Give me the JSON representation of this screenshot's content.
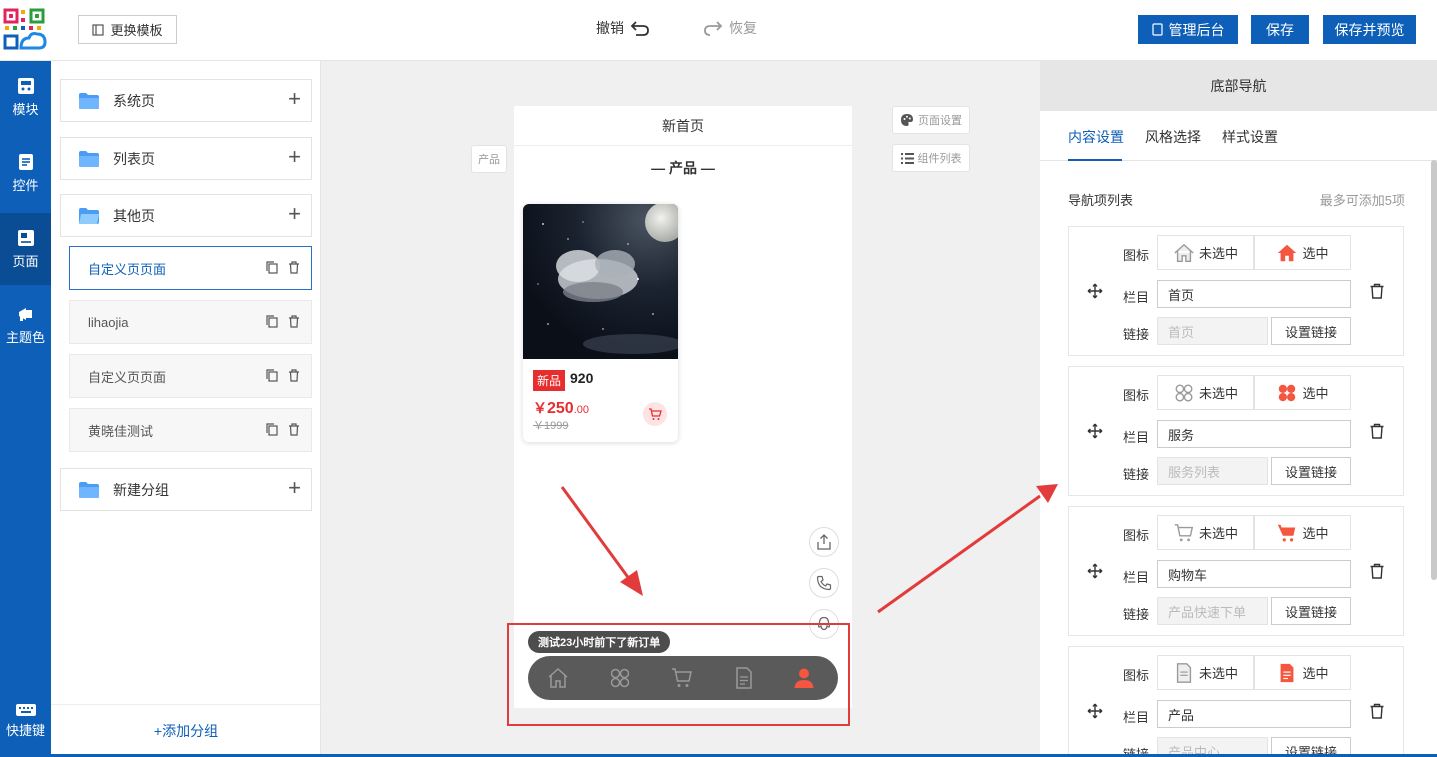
{
  "header": {
    "template_btn": "更换模板",
    "undo": "撤销",
    "redo": "恢复",
    "admin_btn": "管理后台",
    "save_btn": "保存",
    "save_preview_btn": "保存并预览"
  },
  "sidebar": {
    "items": [
      {
        "label": "模块",
        "icon": "module-icon"
      },
      {
        "label": "控件",
        "icon": "widget-icon"
      },
      {
        "label": "页面",
        "icon": "page-icon"
      },
      {
        "label": "主题色",
        "icon": "megaphone-icon"
      }
    ],
    "shortcut": "快捷键"
  },
  "pages": {
    "groups": [
      "系统页",
      "列表页",
      "其他页",
      "新建分组"
    ],
    "items": [
      "自定义页页面",
      "lihaojia",
      "自定义页页面",
      "黄晓佳测试"
    ],
    "add_group": "+添加分组"
  },
  "canvas": {
    "page_title": "新首页",
    "side_tag_left": "产品",
    "page_settings": "页面设置",
    "component_list": "组件列表",
    "section_title": "— 产品 —",
    "product": {
      "badge": "新品",
      "name": "920",
      "price_symbol": "￥",
      "price_int": "250",
      "price_dec": ".00",
      "old_price": "￥1999"
    },
    "ticker": "测试23小时前下了新订单"
  },
  "right_panel": {
    "title": "底部导航",
    "tabs": [
      "内容设置",
      "风格选择",
      "样式设置"
    ],
    "list_label": "导航项列表",
    "list_hint": "最多可添加5项",
    "label_icon": "图标",
    "label_column": "栏目",
    "label_link": "链接",
    "unselected": "未选中",
    "selected": "选中",
    "set_link": "设置链接",
    "nav_items": [
      {
        "name": "首页",
        "link": "首页",
        "icon": "home-icon"
      },
      {
        "name": "服务",
        "link": "服务列表",
        "icon": "grid-icon"
      },
      {
        "name": "购物车",
        "link": "产品快速下单",
        "icon": "cart-icon"
      },
      {
        "name": "产品",
        "link": "产品中心",
        "icon": "document-icon"
      }
    ]
  },
  "colors": {
    "brand": "#0d5fb8",
    "accent_red": "#e62e2e",
    "arrow": "#e23b3b"
  }
}
